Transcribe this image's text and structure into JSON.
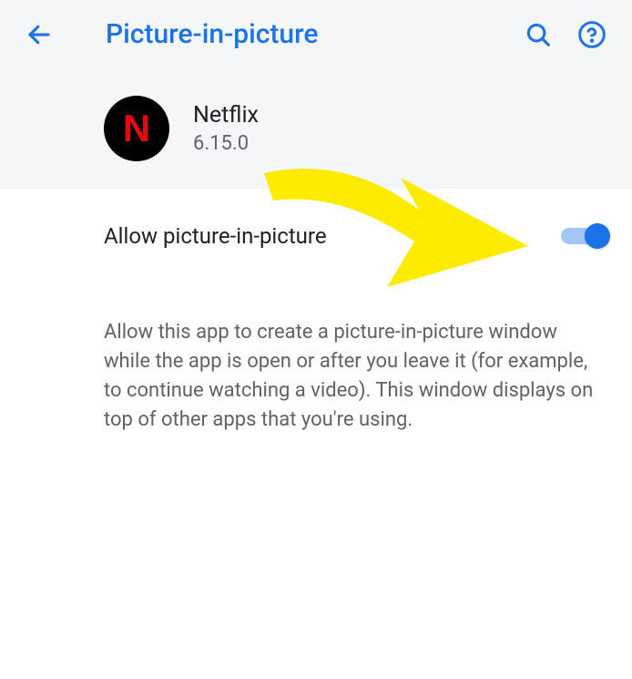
{
  "header": {
    "title": "Picture-in-picture"
  },
  "app": {
    "name": "Netflix",
    "version": "6.15.0",
    "icon_letter": "N"
  },
  "setting": {
    "label": "Allow picture-in-picture",
    "enabled": true
  },
  "description": "Allow this app to create a picture-in-picture window while the app is open or after you leave it (for ex­ample, to continue watching a video). This window displays on top of other apps that you're using.",
  "colors": {
    "accent": "#1a73e8",
    "header_bg": "#f5f6f8",
    "text_primary": "#202124",
    "text_secondary": "#5f6368",
    "annotation": "#fdec00"
  }
}
